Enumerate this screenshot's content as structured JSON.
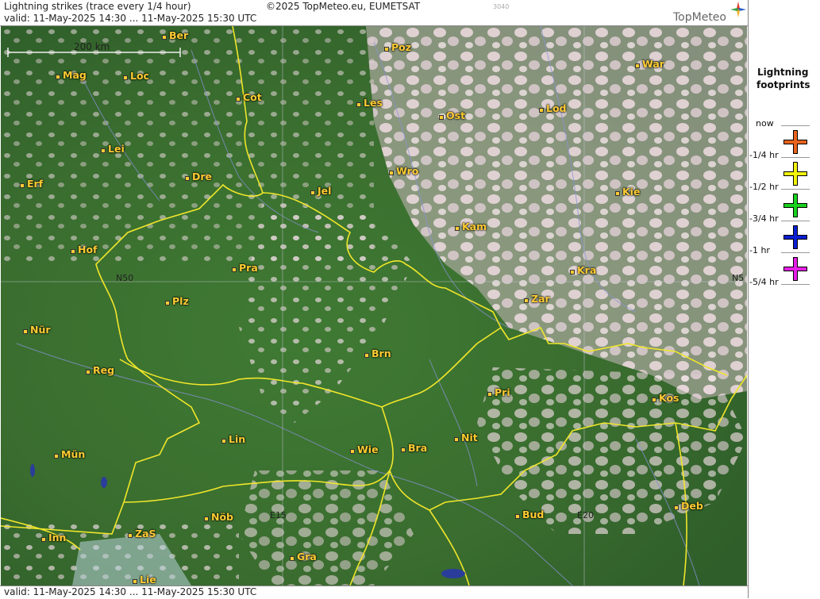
{
  "header": {
    "title": "Lightning strikes (trace every 1/4 hour)",
    "copyright": "©2025 TopMeteo.eu, EUMETSAT",
    "code": "3040",
    "valid": "valid:  11-May-2025 14:30 ... 11-May-2025 15:30 UTC",
    "brand": "TopMeteo"
  },
  "footer": {
    "valid": "valid:  11-May-2025 14:30 ... 11-May-2025 15:30 UTC"
  },
  "map": {
    "scale_label": "200 km",
    "coords": {
      "lat_left": "N50",
      "lat_right": "N5",
      "lon_a": "E15",
      "lon_b": "E20"
    },
    "cities": [
      "Ber",
      "Poz",
      "War",
      "Mag",
      "Loc",
      "Cot",
      "Les",
      "Ost",
      "Lod",
      "Lei",
      "Dre",
      "Wro",
      "Erf",
      "Jel",
      "Kie",
      "Kam",
      "Hof",
      "Pra",
      "Kra",
      "Plz",
      "Zar",
      "Nür",
      "Brn",
      "Reg",
      "Pri",
      "Kos",
      "Lin",
      "Nit",
      "Mün",
      "Wie",
      "Bra",
      "Deb",
      "Nöb",
      "Bud",
      "Inn",
      "ZaS",
      "Gra",
      "Lie"
    ]
  },
  "legend": {
    "title_1": "Lightning",
    "title_2": "footprints",
    "items": [
      {
        "label": "now",
        "color": ""
      },
      {
        "label": "-1/4 hr",
        "color": "#e8641e"
      },
      {
        "label": "-1/2 hr",
        "color": "#f2f20a"
      },
      {
        "label": "-3/4 hr",
        "color": "#19d21e"
      },
      {
        "label": "-1 hr",
        "color": "#0a1ed2"
      },
      {
        "label": "-5/4 hr",
        "color": "#e61ee6"
      }
    ]
  },
  "colors": {
    "border": "#f0e62a",
    "city": "#ffcc33",
    "river": "#8a92d8"
  }
}
